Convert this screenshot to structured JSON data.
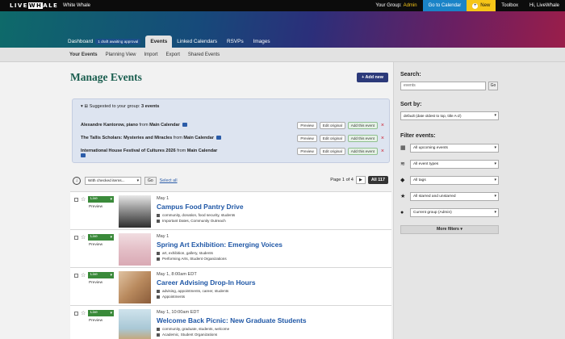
{
  "topbar": {
    "logo_left": "LIVE",
    "logo_mid": "WH",
    "logo_right": "ALE",
    "site_name": "White Whale",
    "group_label": "Your Group:",
    "group_value": "Admin",
    "go_to_calendar": "Go to Calendar",
    "new_label": "New",
    "toolbox": "Toolbox",
    "greeting": "Hi, LiveWhale"
  },
  "tabs": [
    {
      "label": "Dashboard",
      "badge": "1 draft awaiting approval"
    },
    {
      "label": "Events"
    },
    {
      "label": "Linked Calendars"
    },
    {
      "label": "RSVPs"
    },
    {
      "label": "Images"
    }
  ],
  "subnav": [
    "Your Events",
    "Planning View",
    "Import",
    "Export",
    "Shared Events"
  ],
  "main": {
    "title": "Manage Events",
    "add_new": "Add new",
    "suggest": {
      "head_prefix": "Suggested to your group:",
      "head_count": "3 events",
      "rows": [
        {
          "name": "Alexandre Kantorow, piano",
          "from": "from",
          "calendar": "Main Calendar"
        },
        {
          "name": "The Tallis Scholars: Mysteries and Miracles",
          "from": "from",
          "calendar": "Main Calendar"
        },
        {
          "name": "International House Festival of Cultures 2026",
          "from": "from",
          "calendar": "Main Calendar"
        }
      ],
      "btn_preview": "Preview",
      "btn_edit": "Edit original",
      "btn_add": "Add this event"
    },
    "bulk": {
      "with_checked": "With checked items...",
      "go": "Go",
      "select_all": "Select all",
      "page_info": "Page 1 of 4",
      "next": "▶",
      "all": "All 117"
    },
    "events": [
      {
        "date": "May 1",
        "title": "Campus Food Pantry Drive",
        "tags": "community, donation, food security, students",
        "cats": "Important Dates, Community Outreach",
        "live": "Live",
        "preview": "Preview",
        "thumb": "#5a5a5a"
      },
      {
        "date": "May 1",
        "title": "Spring Art Exhibition: Emerging Voices",
        "tags": "art, exhibition, gallery, students",
        "cats": "Performing Arts, Student Organizations",
        "live": "Live",
        "preview": "Preview",
        "thumb": "#e9c9cf"
      },
      {
        "date": "May 1, 8:00am EDT",
        "title": "Career Advising Drop-In Hours",
        "tags": "advising, appointments, career, students",
        "cats": "Appointments",
        "live": "Live",
        "preview": "Preview",
        "thumb": "#c9a07a"
      },
      {
        "date": "May 1, 10:00am EDT",
        "title": "Welcome Back Picnic: New Graduate Students",
        "tags": "community, graduate, students, welcome",
        "cats": "Academic, Student Organizations",
        "live": "Live",
        "preview": "Preview",
        "thumb": "#b7cfd9"
      }
    ]
  },
  "sidebar": {
    "search_label": "Search:",
    "search_value": "events",
    "search_go": "Go",
    "sort_label": "Sort by:",
    "sort_value": "default (date oldest to top, title A-Z)",
    "filter_label": "Filter events:",
    "filters": [
      {
        "icon": "calendar-icon",
        "value": "All upcoming events"
      },
      {
        "icon": "layers-icon",
        "value": "All event types"
      },
      {
        "icon": "tag-icon",
        "value": "All tags"
      },
      {
        "icon": "star-icon",
        "value": "All starred and unstarred"
      },
      {
        "icon": "users-icon",
        "value": "Current group (Admin)"
      }
    ],
    "more_filters": "More filters"
  },
  "colors": {
    "accent_green": "#1a5e4f",
    "link_blue": "#1f57a6",
    "live_green": "#3a8a3a",
    "calendar_blue": "#1a83c7",
    "new_yellow": "#f5c518"
  }
}
